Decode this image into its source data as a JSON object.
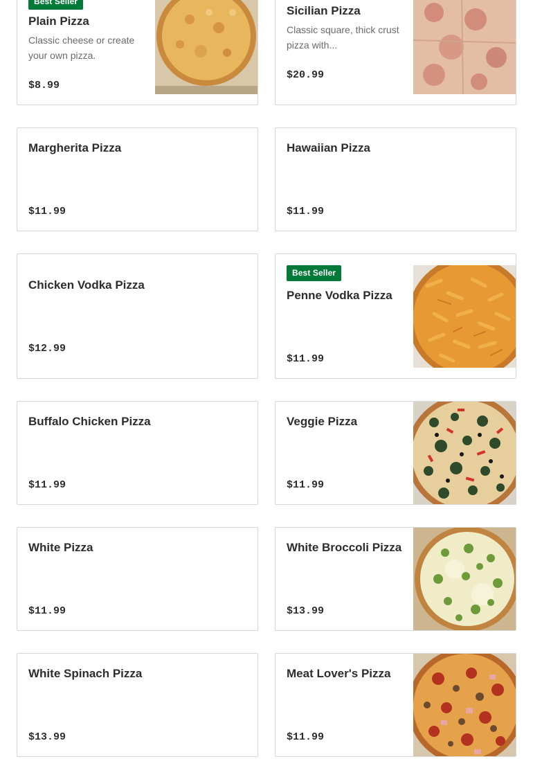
{
  "menu": {
    "items": [
      {
        "name": "Plain Pizza",
        "description": "Classic cheese or create your own pizza.",
        "price": "$8.99",
        "badge": "Best Seller",
        "image": "plain-pizza-photo"
      },
      {
        "name": "Sicilian Pizza",
        "description": "Classic square, thick crust pizza with...",
        "price": "$20.99",
        "badge": "",
        "image": "sicilian-pizza-photo"
      },
      {
        "name": "Margherita Pizza",
        "description": "",
        "price": "$11.99",
        "badge": "",
        "image": ""
      },
      {
        "name": "Hawaiian Pizza",
        "description": "",
        "price": "$11.99",
        "badge": "",
        "image": ""
      },
      {
        "name": "Chicken Vodka Pizza",
        "description": "",
        "price": "$12.99",
        "badge": "",
        "image": ""
      },
      {
        "name": "Penne Vodka Pizza",
        "description": "",
        "price": "$11.99",
        "badge": "Best Seller",
        "image": "penne-vodka-pizza-photo"
      },
      {
        "name": "Buffalo Chicken Pizza",
        "description": "",
        "price": "$11.99",
        "badge": "",
        "image": ""
      },
      {
        "name": "Veggie Pizza",
        "description": "",
        "price": "$11.99",
        "badge": "",
        "image": "veggie-pizza-photo"
      },
      {
        "name": "White Pizza",
        "description": "",
        "price": "$11.99",
        "badge": "",
        "image": ""
      },
      {
        "name": "White Broccoli Pizza",
        "description": "",
        "price": "$13.99",
        "badge": "",
        "image": "white-broccoli-pizza-photo"
      },
      {
        "name": "White Spinach Pizza",
        "description": "",
        "price": "$13.99",
        "badge": "",
        "image": ""
      },
      {
        "name": "Meat Lover's Pizza",
        "description": "",
        "price": "$11.99",
        "badge": "",
        "image": "meat-lovers-pizza-photo"
      }
    ]
  },
  "colors": {
    "badge_background": "#047a38",
    "badge_text": "#ffffff",
    "card_border": "#d6d6d6",
    "title_text": "#2d2d2d",
    "description_text": "#6b6b6b"
  }
}
